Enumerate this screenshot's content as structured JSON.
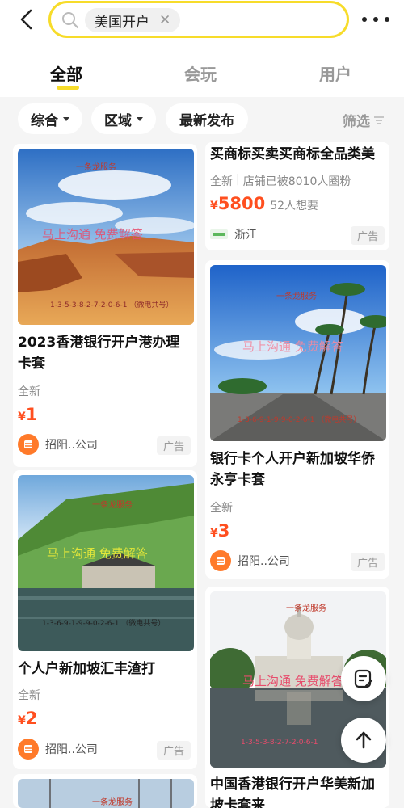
{
  "search": {
    "query": "美国开户"
  },
  "tabs": [
    {
      "label": "全部"
    },
    {
      "label": "会玩"
    },
    {
      "label": "用户"
    }
  ],
  "filters": {
    "sort": "综合",
    "region": "区域",
    "latest": "最新发布",
    "screen": "筛选"
  },
  "overlay": {
    "service": "一条龙服务",
    "contact": "马上沟通  免费解答",
    "phone1": "1-3-5-3-8-2-7-2-0-6-1 （微电共号）",
    "phone2": "1-3-6-9-1-9-9-0-2-6-1 （微电共号）",
    "phone3": "1-3-6-9-1-9-9-0-2-6-1 （微电共号）",
    "phone4": "1-3-5-3-8-2-7-2-0-6-1"
  },
  "cards": {
    "left1": {
      "title_line1": "2023香港银行开户港办理",
      "title_line2": "卡套",
      "condition": "全新",
      "price_symbol": "¥",
      "price": "1",
      "seller": "招阳..公司",
      "badge": "广告"
    },
    "right1": {
      "title_line1": "买商标买卖买商标全品类美",
      "condition": "全新",
      "divider": "|",
      "store_note": "店铺已被8010人圈粉",
      "price_symbol": "¥",
      "price": "5800",
      "wants": "52人想要",
      "location": "浙江",
      "badge": "广告"
    },
    "right2": {
      "title_line1": "银行卡个人开户新加坡华侨",
      "title_line2": "永亨卡套",
      "condition": "全新",
      "price_symbol": "¥",
      "price": "3",
      "seller": "招阳..公司",
      "badge": "广告"
    },
    "left2": {
      "title_line1": "个人户新加坡汇丰渣打",
      "condition": "全新",
      "price_symbol": "¥",
      "price": "2",
      "seller": "招阳..公司",
      "badge": "广告"
    },
    "right3": {
      "title_line1": "中国香港银行开户华美新加",
      "title_line2": "坡卡套来"
    }
  },
  "colors": {
    "accent": "#f7dc2a",
    "price": "#ff4f1f",
    "seller_icon": "#ff7a2a"
  }
}
